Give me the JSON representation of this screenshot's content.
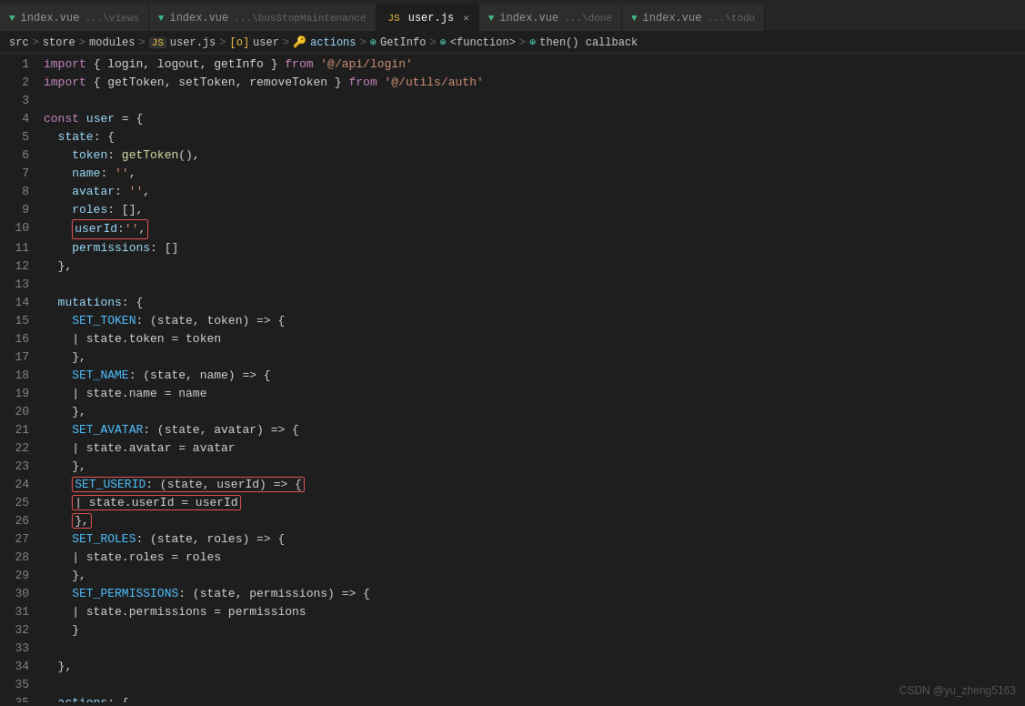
{
  "tabs": [
    {
      "id": "tab1",
      "icon": "vue",
      "label": "index.vue",
      "path": "...\\views",
      "active": false,
      "closable": false
    },
    {
      "id": "tab2",
      "icon": "vue",
      "label": "index.vue",
      "path": "...\\busStopMaintenance",
      "active": false,
      "closable": false
    },
    {
      "id": "tab3",
      "icon": "js",
      "label": "user.js",
      "path": "",
      "active": true,
      "closable": true
    },
    {
      "id": "tab4",
      "icon": "vue",
      "label": "index.vue",
      "path": "...\\done",
      "active": false,
      "closable": false
    },
    {
      "id": "tab5",
      "icon": "vue",
      "label": "index.vue",
      "path": "...\\todo",
      "active": false,
      "closable": false
    }
  ],
  "breadcrumb": {
    "parts": [
      "src",
      ">",
      "store",
      ">",
      "modules",
      ">",
      "JS user.js",
      ">",
      "[o] user",
      ">",
      "⚙ actions",
      ">",
      "⊕ GetInfo",
      ">",
      "⊕ <function>",
      ">",
      "⊕ then() callback"
    ]
  },
  "watermark": "CSDN @yu_zheng5163"
}
